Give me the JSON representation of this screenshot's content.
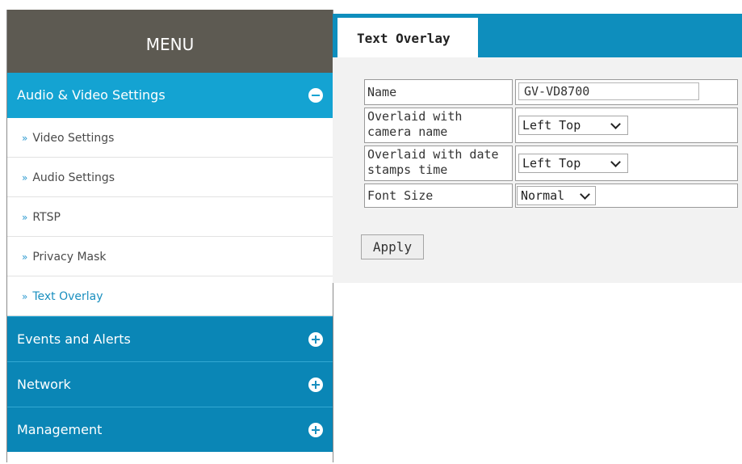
{
  "sidebar": {
    "title": "MENU",
    "sections": [
      {
        "label": "Audio & Video Settings",
        "state": "expanded",
        "icon": "minus-circle-icon"
      },
      {
        "label": "Events and Alerts",
        "state": "collapsed",
        "icon": "plus-circle-icon"
      },
      {
        "label": "Network",
        "state": "collapsed",
        "icon": "plus-circle-icon"
      },
      {
        "label": "Management",
        "state": "collapsed",
        "icon": "plus-circle-icon"
      }
    ],
    "sub_items": [
      {
        "label": "Video Settings"
      },
      {
        "label": "Audio Settings"
      },
      {
        "label": "RTSP"
      },
      {
        "label": "Privacy Mask"
      },
      {
        "label": "Text Overlay",
        "selected": true
      }
    ],
    "arrow_glyph": "»"
  },
  "main": {
    "tab_label": "Text Overlay",
    "form": {
      "name_label": "Name",
      "name_value": "GV-VD8700",
      "camera_name_label_line1": "Overlaid with",
      "camera_name_label_line2": "camera name",
      "camera_name_value": "Left Top",
      "date_label_line1": "Overlaid with date",
      "date_label_line2": "stamps time",
      "date_value": "Left Top",
      "font_size_label": "Font Size",
      "font_size_value": "Normal"
    },
    "apply_label": "Apply"
  },
  "colors": {
    "menu_header_bg": "#5d5a52",
    "active_section_bg": "#14a3d2",
    "collapsed_section_bg": "#0a86b6",
    "top_bar_bg": "#0e8ebd",
    "content_bg": "#f2f2f2"
  }
}
